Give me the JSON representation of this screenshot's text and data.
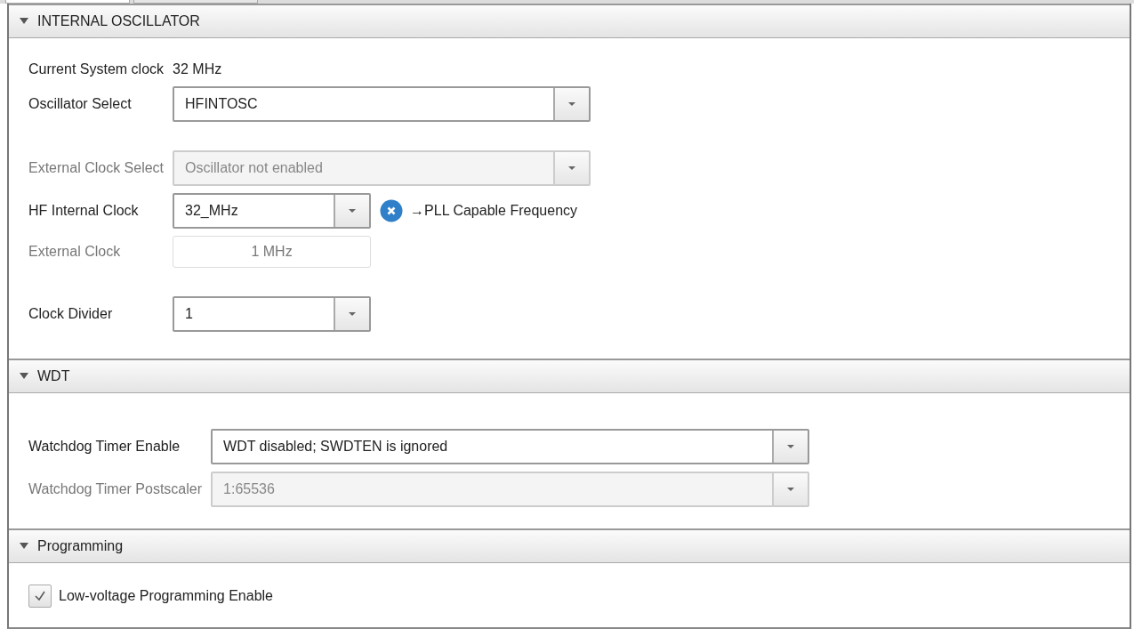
{
  "tabs": [
    {
      "selected": true
    },
    {
      "selected": false
    }
  ],
  "sections": [
    {
      "title": "INTERNAL OSCILLATOR",
      "expanded": true,
      "rows": [
        {
          "kind": "readout",
          "label": "Current System clock",
          "value": "32 MHz",
          "spaced": false
        },
        {
          "kind": "select",
          "label": "Oscillator Select",
          "value": "HFINTOSC",
          "disabled": false,
          "spaced": false
        },
        {
          "kind": "select",
          "label": "External Clock Select",
          "value": "Oscillator not enabled",
          "disabled": true,
          "spaced": true
        },
        {
          "kind": "short-select",
          "label": "HF Internal Clock",
          "value": "32_MHz",
          "disabled": false,
          "spaced": false,
          "note": "→PLL Capable Frequency"
        },
        {
          "kind": "field",
          "label": "External Clock",
          "value": "1 MHz",
          "disabled": true,
          "spaced": false
        },
        {
          "kind": "short-select",
          "label": "Clock Divider",
          "value": "1",
          "disabled": false,
          "spaced": true
        }
      ]
    },
    {
      "title": "WDT",
      "expanded": true,
      "rows": [
        {
          "kind": "long-select",
          "label": "Watchdog Timer Enable",
          "value": "WDT disabled; SWDTEN is ignored",
          "disabled": false,
          "spaced": true
        },
        {
          "kind": "long-select",
          "label": "Watchdog Timer Postscaler",
          "value": "1:65536",
          "disabled": true,
          "spaced": false
        }
      ]
    },
    {
      "title": "Programming",
      "expanded": true,
      "rows": [
        {
          "kind": "checkbox",
          "label": "Low-voltage Programming Enable",
          "checked": true,
          "disabled": false
        }
      ]
    }
  ]
}
